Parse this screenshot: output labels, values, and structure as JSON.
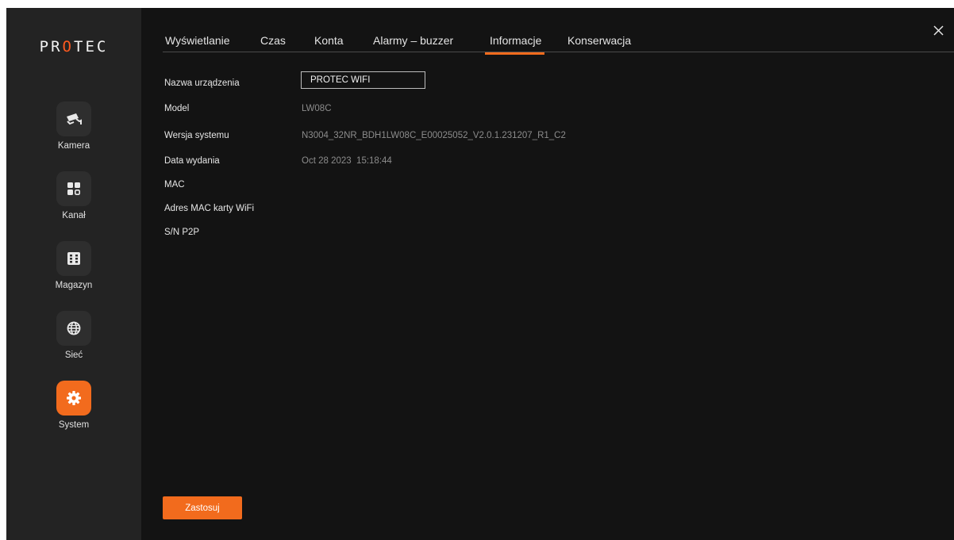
{
  "brand": {
    "logo_pre": "PR",
    "logo_hl": "O",
    "logo_post": "TEC"
  },
  "sidebar": {
    "items": [
      {
        "label": "Kamera",
        "icon": "camera-icon",
        "active": false
      },
      {
        "label": "Kanał",
        "icon": "channel-grid-icon",
        "active": false
      },
      {
        "label": "Magazyn",
        "icon": "storage-icon",
        "active": false
      },
      {
        "label": "Sieć",
        "icon": "globe-icon",
        "active": false
      },
      {
        "label": "System",
        "icon": "gear-icon",
        "active": true
      }
    ]
  },
  "tabs": [
    {
      "label": "Wyświetlanie",
      "active": false
    },
    {
      "label": "Czas",
      "active": false
    },
    {
      "label": "Konta",
      "active": false
    },
    {
      "label": "Alarmy – buzzer",
      "active": false
    },
    {
      "label": "Informacje",
      "active": true
    },
    {
      "label": "Konserwacja",
      "active": false
    }
  ],
  "info": {
    "device_name_label": "Nazwa urządzenia",
    "device_name_value": "PROTEC WIFI",
    "model_label": "Model",
    "model_value": "LW08C",
    "version_label": "Wersja systemu",
    "version_value": "N3004_32NR_BDH1LW08C_E00025052_V2.0.1.231207_R1_C2",
    "release_label": "Data wydania",
    "release_value": "Oct 28 2023  15:18:44",
    "mac_label": "MAC",
    "mac_value": "",
    "wifi_mac_label": "Adres MAC karty WiFi",
    "wifi_mac_value": "",
    "p2p_label": "S/N P2P",
    "p2p_value": ""
  },
  "actions": {
    "apply_label": "Zastosuj"
  },
  "colors": {
    "accent": "#f26b1d",
    "background": "#131313",
    "sidebar": "#232323"
  }
}
